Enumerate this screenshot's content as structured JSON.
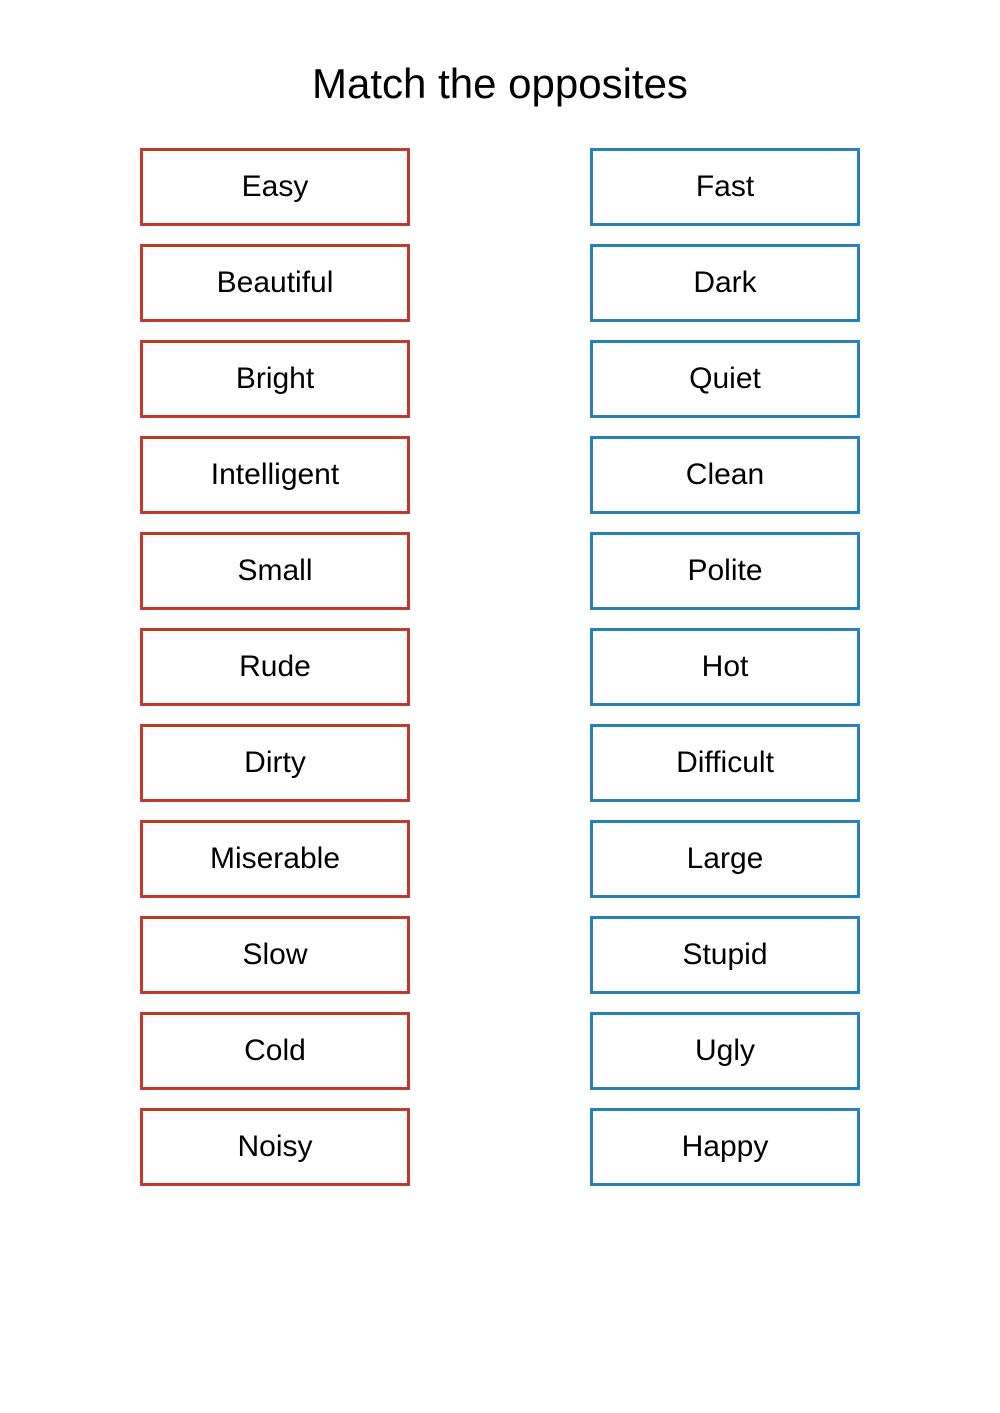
{
  "title": "Match the opposites",
  "left_column": [
    "Easy",
    "Beautiful",
    "Bright",
    "Intelligent",
    "Small",
    "Rude",
    "Dirty",
    "Miserable",
    "Slow",
    "Cold",
    "Noisy"
  ],
  "right_column": [
    "Fast",
    "Dark",
    "Quiet",
    "Clean",
    "Polite",
    "Hot",
    "Difficult",
    "Large",
    "Stupid",
    "Ugly",
    "Happy"
  ]
}
